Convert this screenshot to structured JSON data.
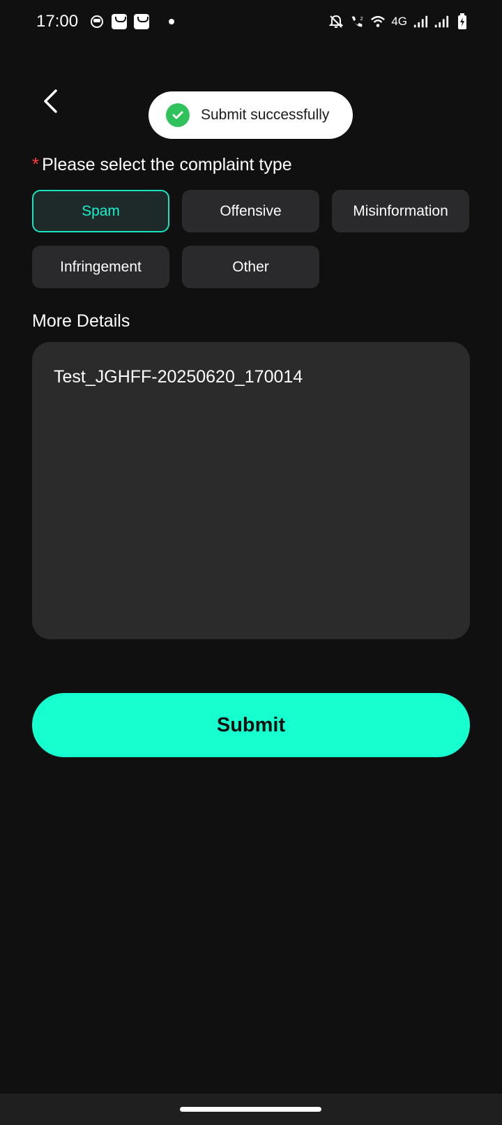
{
  "status_bar": {
    "time": "17:00",
    "network": "4G",
    "icons": [
      "app-notification-icon",
      "shopping-bag-icon",
      "shopping-bag-icon",
      "dot-icon",
      "bell-off-icon",
      "call-icon",
      "wifi-icon",
      "signal-icon",
      "signal-icon",
      "battery-charging-icon"
    ]
  },
  "toast": {
    "text": "Submit successfully",
    "icon": "check-circle-icon",
    "color": "#2fc25b"
  },
  "complaint": {
    "required_marker": "*",
    "title": "Please select the complaint type",
    "options": [
      {
        "label": "Spam",
        "selected": true
      },
      {
        "label": "Offensive",
        "selected": false
      },
      {
        "label": "Misinformation",
        "selected": false
      },
      {
        "label": "Infringement",
        "selected": false
      },
      {
        "label": "Other",
        "selected": false
      }
    ]
  },
  "details": {
    "label": "More Details",
    "value": "Test_JGHFF-20250620_170014"
  },
  "submit": {
    "label": "Submit"
  },
  "colors": {
    "accent": "#16ffcf",
    "background": "#101011",
    "required": "#ff3b3b"
  }
}
